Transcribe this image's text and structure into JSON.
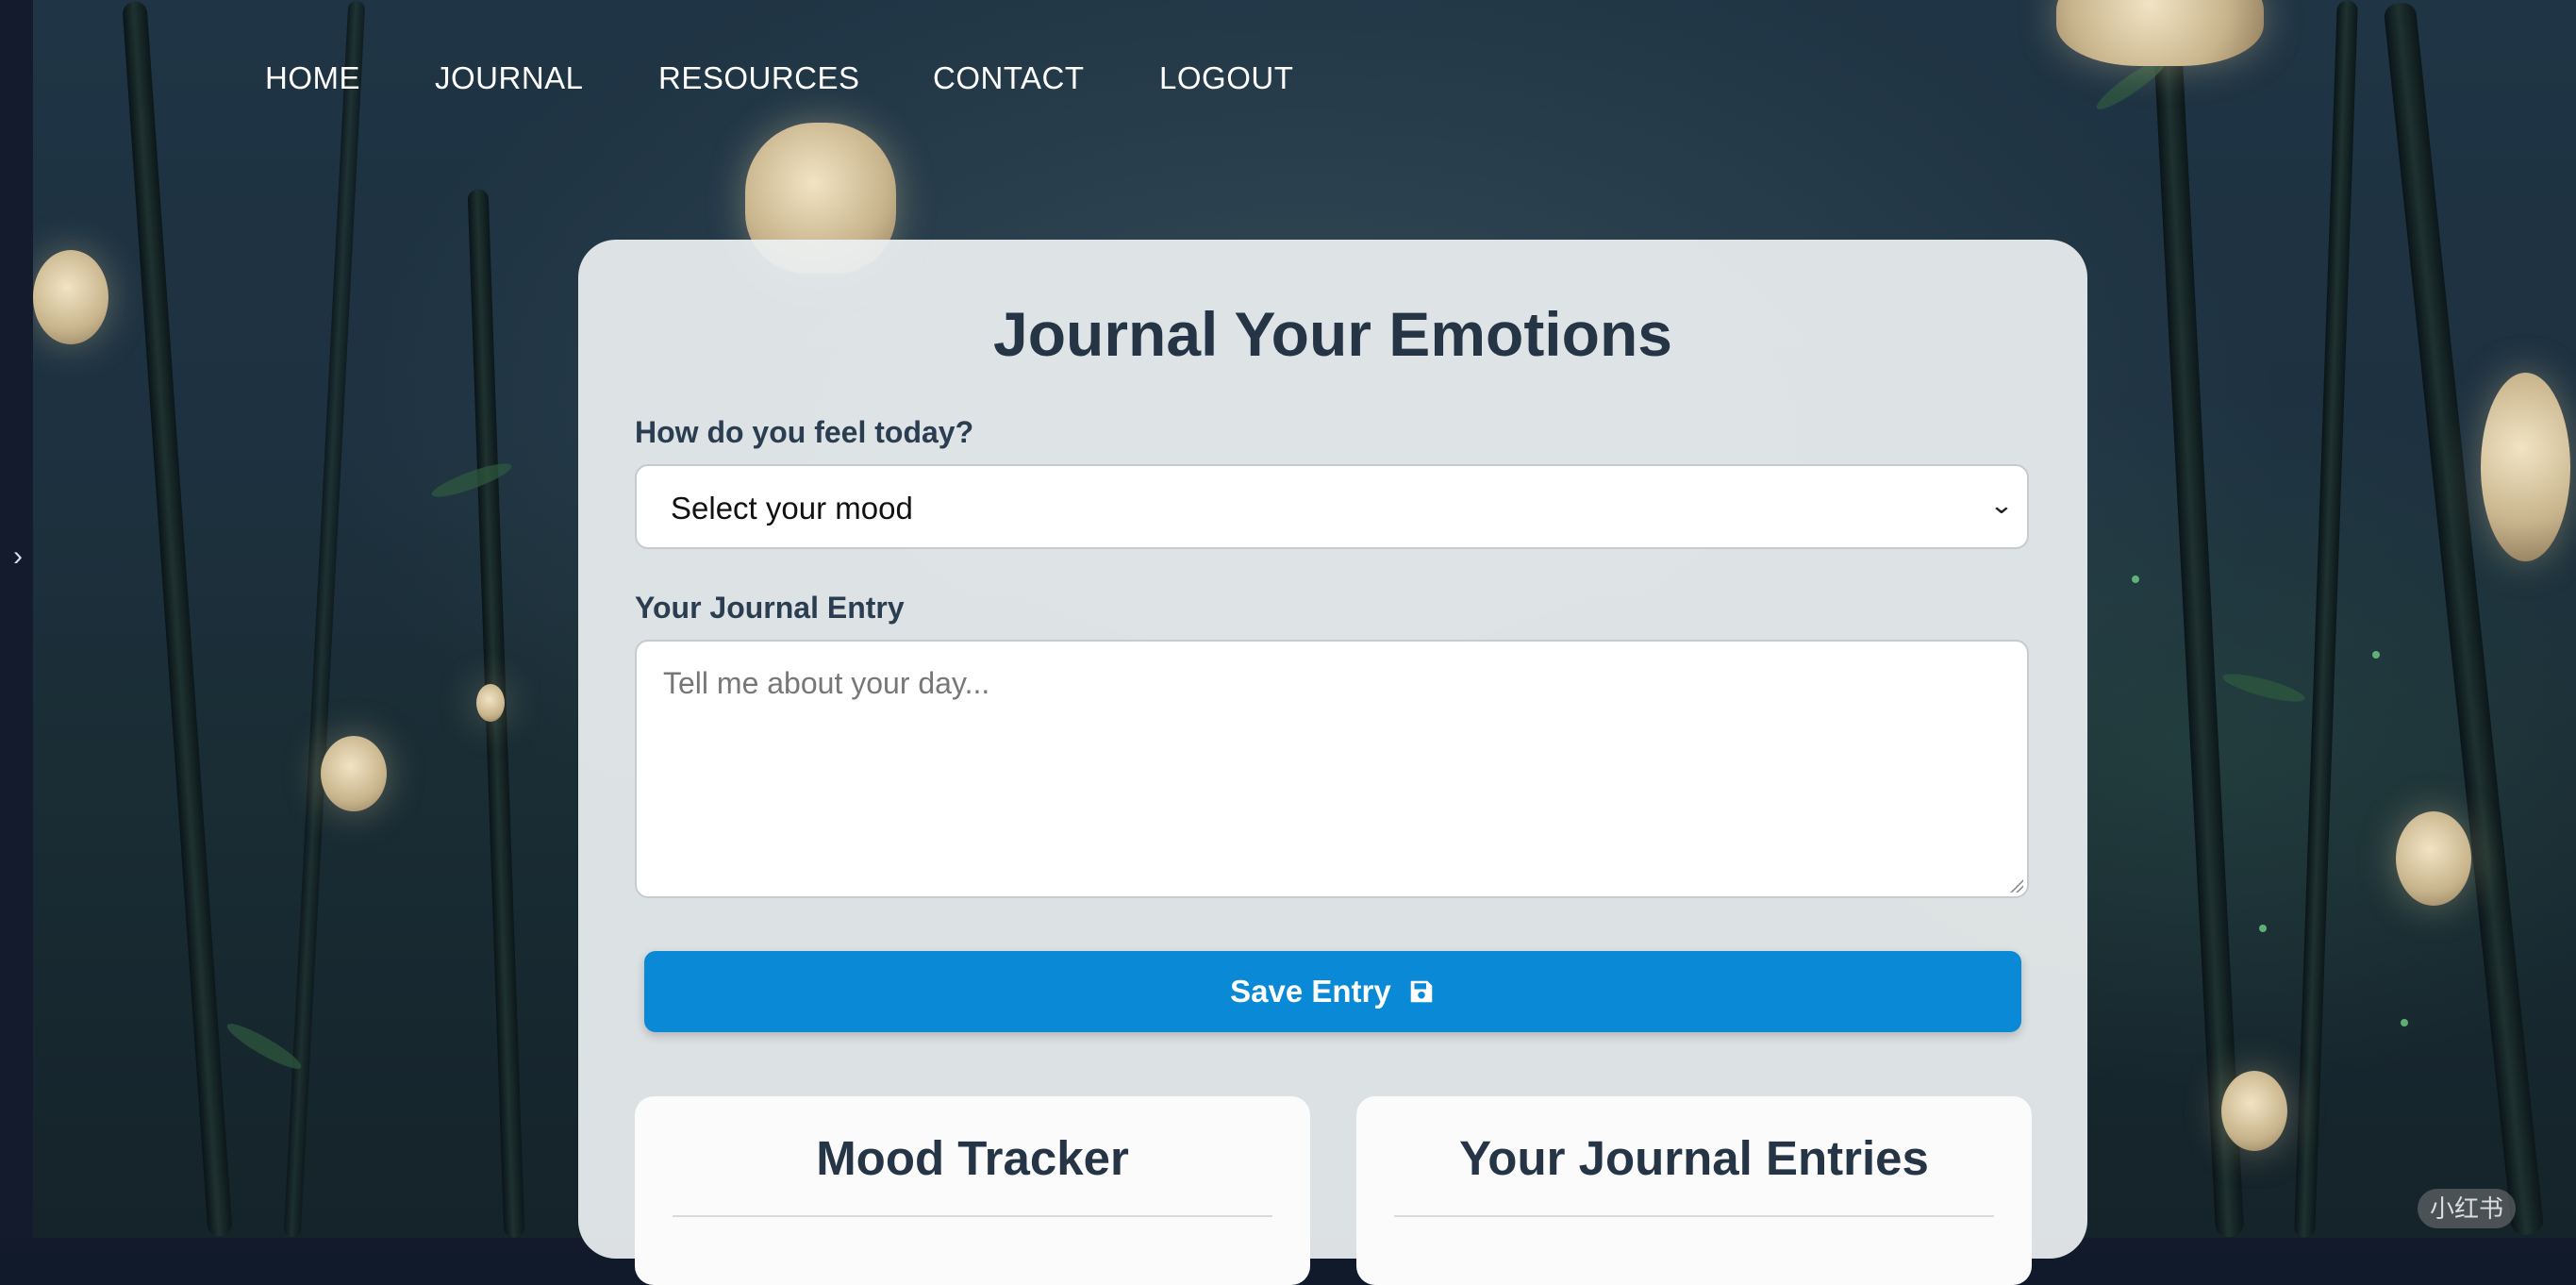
{
  "nav": {
    "items": [
      "HOME",
      "JOURNAL",
      "RESOURCES",
      "CONTACT",
      "LOGOUT"
    ]
  },
  "journal": {
    "title": "Journal Your Emotions",
    "mood_label": "How do you feel today?",
    "mood_select": {
      "selected": "Select your mood"
    },
    "entry_label": "Your Journal Entry",
    "entry_placeholder": "Tell me about your day...",
    "save_label": "Save Entry",
    "save_icon": "floppy-disk-icon"
  },
  "panels": {
    "mood_tracker_title": "Mood Tracker",
    "entries_title": "Your Journal Entries"
  },
  "sidebar_toggle_icon": "chevron-right-icon",
  "watermark": "小红书",
  "colors": {
    "accent": "#0a8ad6",
    "heading": "#253546",
    "card_bg": "#ecf0f1",
    "page_dark": "#111a2a"
  }
}
